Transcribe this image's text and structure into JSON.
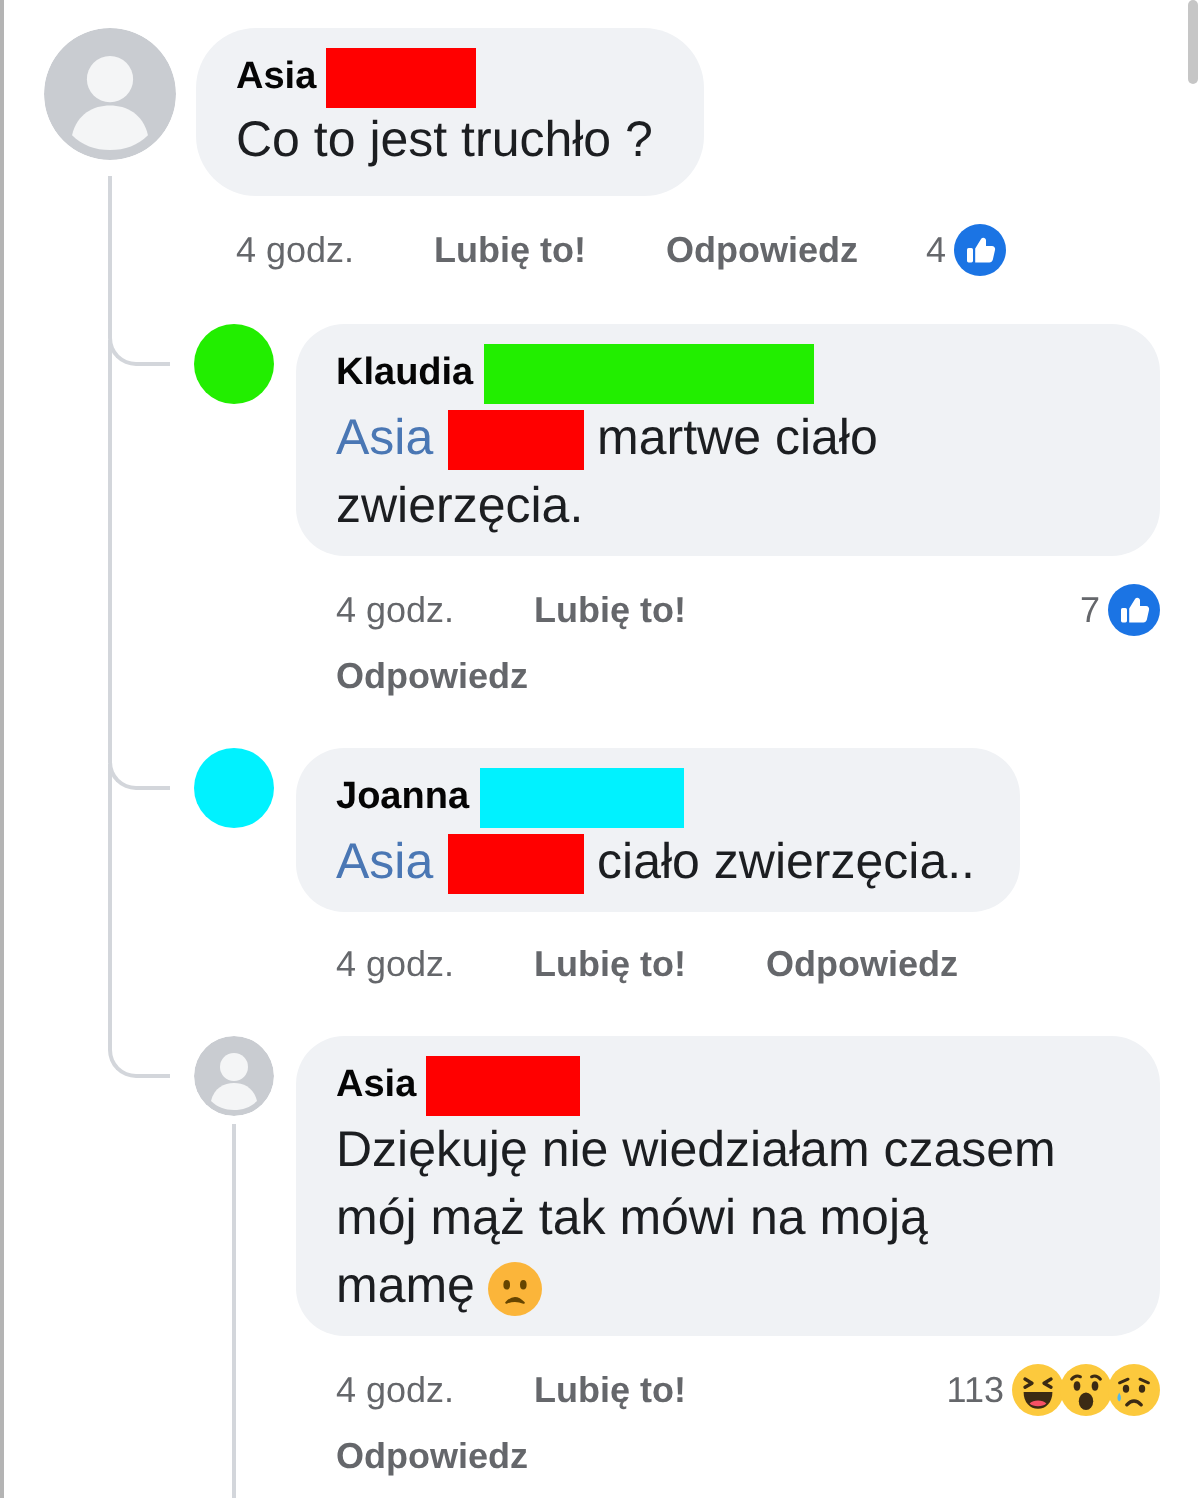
{
  "comments": [
    {
      "author": {
        "name": "Asia",
        "color": "#ff0000"
      },
      "avatar": {
        "kind": "silhouette"
      },
      "body": [
        {
          "kind": "text",
          "text": "Co to jest truchło ?"
        }
      ],
      "time": "4 godz.",
      "like_label": "Lubię to!",
      "reply_label": "Odpowiedz",
      "reactions": {
        "count": "4",
        "icons": [
          {
            "kind": "like"
          }
        ]
      },
      "has_replies": true,
      "replies": [
        {
          "author": {
            "name": "Klaudia",
            "color": "#22ee00"
          },
          "avatar": {
            "kind": "color"
          },
          "body": [
            {
              "kind": "mention",
              "text": "Asia",
              "color": "#ff0000"
            },
            {
              "kind": "text",
              "text": "martwe ciało zwierzęcia."
            }
          ],
          "time": "4 godz.",
          "like_label": "Lubię to!",
          "reply_label": "Odpowiedz",
          "reactions": {
            "count": "7",
            "icons": [
              {
                "kind": "like"
              }
            ]
          },
          "has_replies": false
        },
        {
          "author": {
            "name": "Joanna",
            "color": "#00f2ff"
          },
          "avatar": {
            "kind": "color"
          },
          "body": [
            {
              "kind": "mention",
              "text": "Asia",
              "color": "#ff0000"
            },
            {
              "kind": "text",
              "text": "ciało zwierzęcia.."
            }
          ],
          "time": "4 godz.",
          "like_label": "Lubię to!",
          "reply_label": "Odpowiedz",
          "has_replies": false
        },
        {
          "author": {
            "name": "Asia",
            "color": "#ff0000"
          },
          "avatar": {
            "kind": "silhouette"
          },
          "body": [
            {
              "kind": "text",
              "text": "Dziękuję nie wiedziałam czasem mój mąż tak mówi na moją mamę"
            },
            {
              "kind": "emoji"
            }
          ],
          "time": "4 godz.",
          "like_label": "Lubię to!",
          "reply_label": "Odpowiedz",
          "reactions": {
            "count": "113",
            "icons": [
              {
                "kind": "haha"
              },
              {
                "kind": "wow"
              },
              {
                "kind": "sad"
              }
            ]
          },
          "has_replies": true
        }
      ]
    }
  ]
}
